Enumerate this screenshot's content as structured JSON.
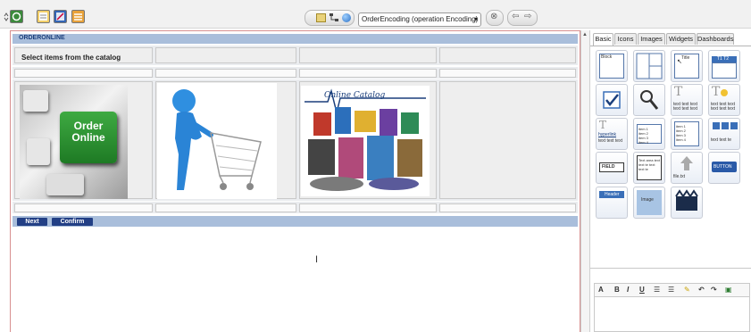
{
  "toolbar": {
    "icons": [
      "expand-icon",
      "recycle-icon",
      "document-list-icon",
      "edit-icon",
      "list-icon"
    ],
    "center_icons": [
      "list-view-icon",
      "flowchart-icon",
      "globe-icon"
    ],
    "process_select": "OrderEncoding (operation Encoding)",
    "colors": {
      "accent": "#223f85",
      "title_bar": "#a9bedb"
    }
  },
  "form": {
    "title": "ORDERONLINE",
    "heading": "Select items from the catalog",
    "images": {
      "order_key_text": "Order Online",
      "catalog_text": "Online Catalog"
    },
    "buttons": {
      "next": "Next",
      "confirm": "Confirm"
    }
  },
  "palette": {
    "tabs": [
      "Basic",
      "Icons",
      "Images",
      "Widgets",
      "Dashboards"
    ],
    "active_tab": "Basic",
    "widgets": {
      "block": "Block",
      "title": "Title",
      "tabs": "T1 T2",
      "text": "text text text text text text",
      "text2": "text text text text text text",
      "hyperlink": "hyperlink",
      "hyperlink_text": "text text text",
      "list": "item 1 item 2 item 3 item 4",
      "combo": "text text te",
      "field": "FIELD",
      "textarea": "Text area text text te text text te",
      "file": "file.txt",
      "button": "BUTTON",
      "header": "Header",
      "image": "Image"
    }
  },
  "editor": {
    "buttons": [
      "A",
      "B",
      "I",
      "U",
      "ordered-list",
      "unordered-list",
      "highlight",
      "undo",
      "redo"
    ]
  }
}
